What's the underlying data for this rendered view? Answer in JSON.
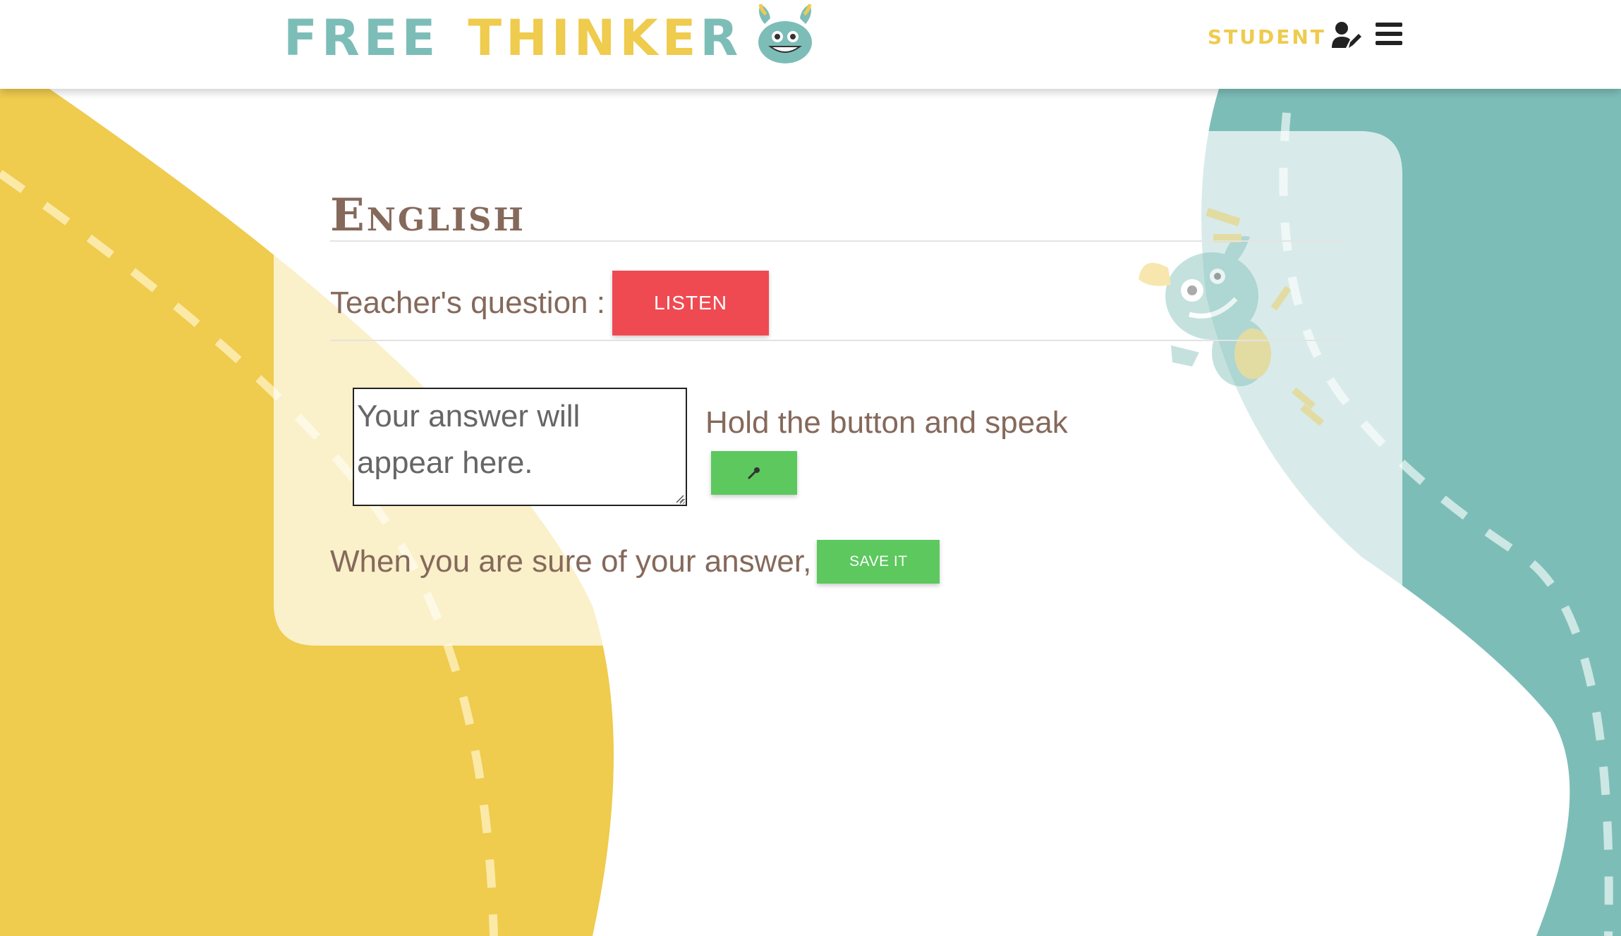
{
  "header": {
    "logo_word1": "FREE",
    "logo_word2": "THINKE",
    "logo_word3": "R",
    "role_label": "STUDENT",
    "user_icon": "user-edit-icon",
    "menu_icon": "hamburger-menu-icon"
  },
  "main": {
    "subject_title": "English",
    "question_label": "Teacher's question :",
    "listen_label": "LISTEN",
    "answer_placeholder": "Your answer will appear here.",
    "speak_instruction": "Hold the button and speak",
    "mic_icon": "microphone-icon",
    "save_prompt": "When you are sure of your answer,",
    "save_label": "SAVE IT"
  },
  "colors": {
    "teal": "#7dbdb8",
    "yellow": "#efcb4e",
    "brown_text": "#85695b",
    "listen_red": "#ef4a52",
    "action_green": "#5cc85e"
  }
}
